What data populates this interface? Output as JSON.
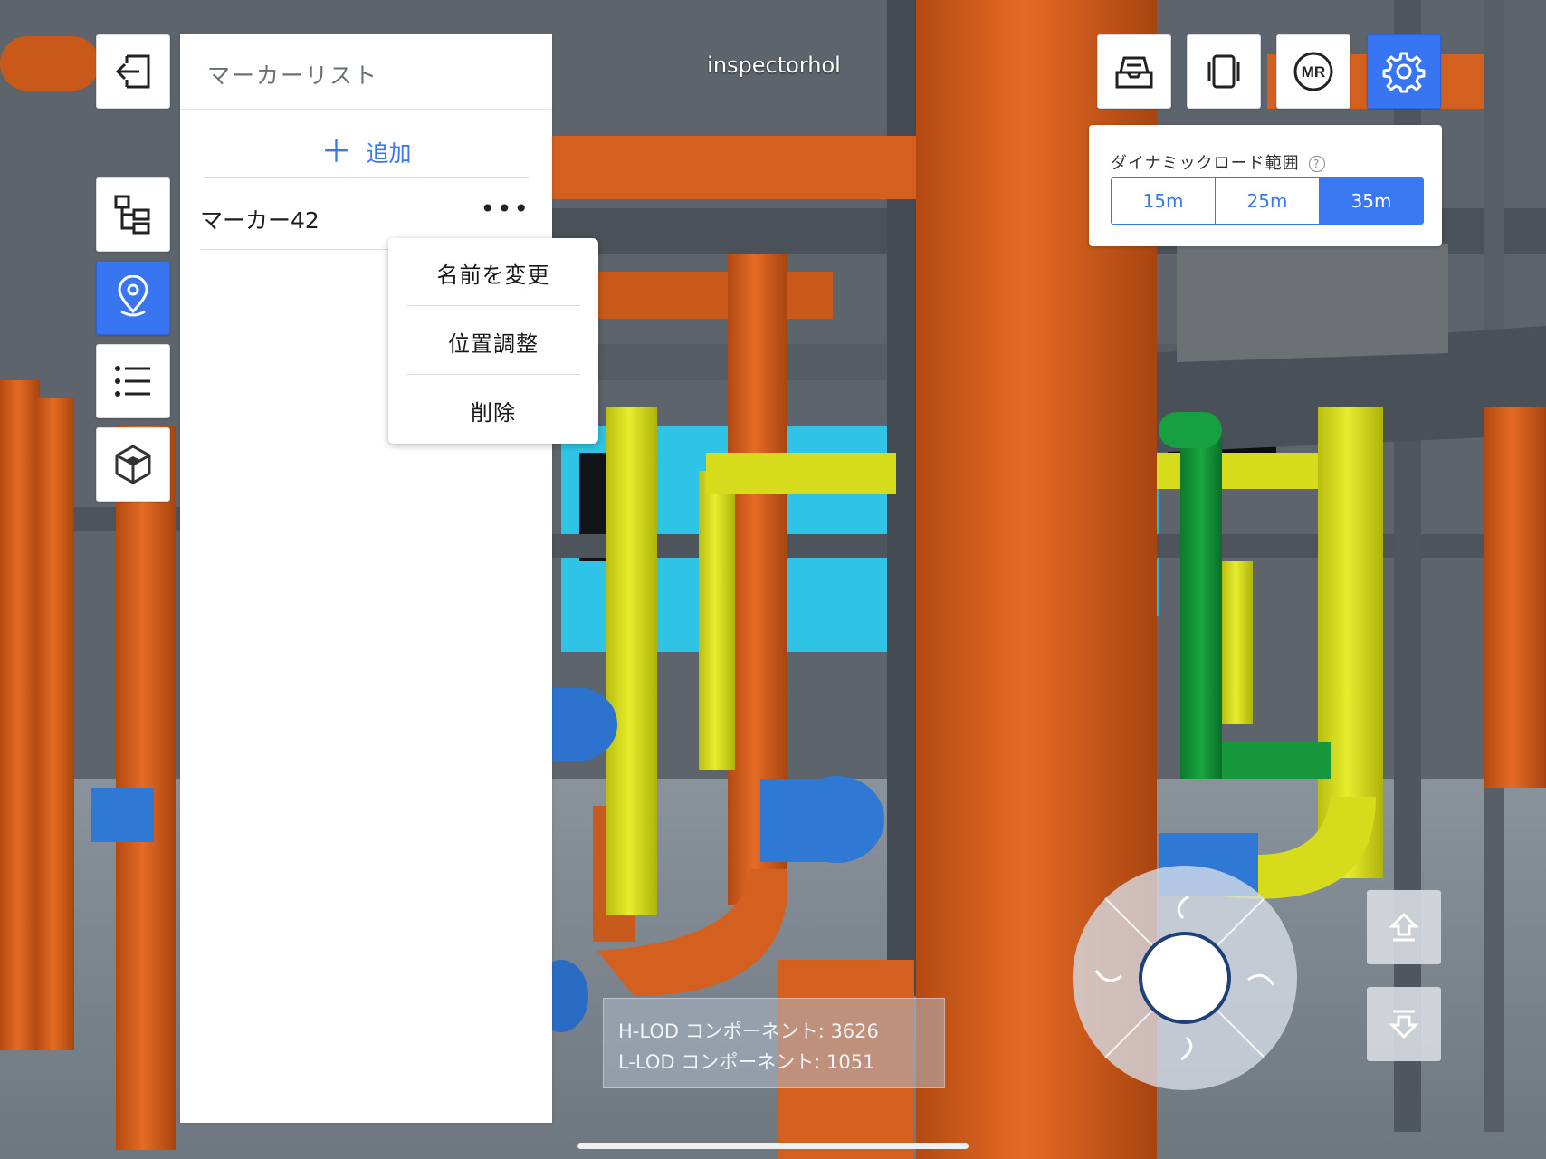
{
  "app": {
    "title": "inspectorhol"
  },
  "left_toolbar": {
    "buttons": [
      {
        "name": "exit-button",
        "icon": "exit-icon"
      },
      {
        "name": "tree-button",
        "icon": "tree-structure-icon"
      },
      {
        "name": "marker-button",
        "icon": "location-pin-icon",
        "active": true
      },
      {
        "name": "list-button",
        "icon": "list-icon"
      },
      {
        "name": "model-button",
        "icon": "cube-icon"
      }
    ]
  },
  "marker_panel": {
    "title": "マーカーリスト",
    "add_icon": "＋",
    "add_label": "追加",
    "items": [
      {
        "name": "マーカー42",
        "more": "•••"
      }
    ]
  },
  "context_menu": {
    "items": [
      "名前を変更",
      "位置調整",
      "削除"
    ]
  },
  "top_toolbar": {
    "buttons": [
      {
        "name": "inbox-button",
        "icon": "inbox-tray-icon"
      },
      {
        "name": "device-button",
        "icon": "device-frame-icon"
      },
      {
        "name": "mr-button",
        "icon": "mr-icon",
        "label": "MR"
      },
      {
        "name": "settings-button",
        "icon": "gear-icon",
        "active": true
      }
    ]
  },
  "dynamic_load": {
    "label": "ダイナミックロード範囲",
    "help_icon": "?",
    "options": [
      "15m",
      "25m",
      "35m"
    ],
    "selected": "35m"
  },
  "lod_info": {
    "h_lod": "H-LOD コンポーネント: 3626",
    "l_lod": "L-LOD コンポーネント: 1051"
  },
  "colors": {
    "accent": "#3875f2",
    "pipe_orange": "#d3601f",
    "pipe_yellow": "#d8dd1c",
    "pipe_green": "#14933a",
    "pipe_blue": "#2f78d4",
    "cyan_wall": "#2fc4e6",
    "steel": "#4e545c"
  }
}
